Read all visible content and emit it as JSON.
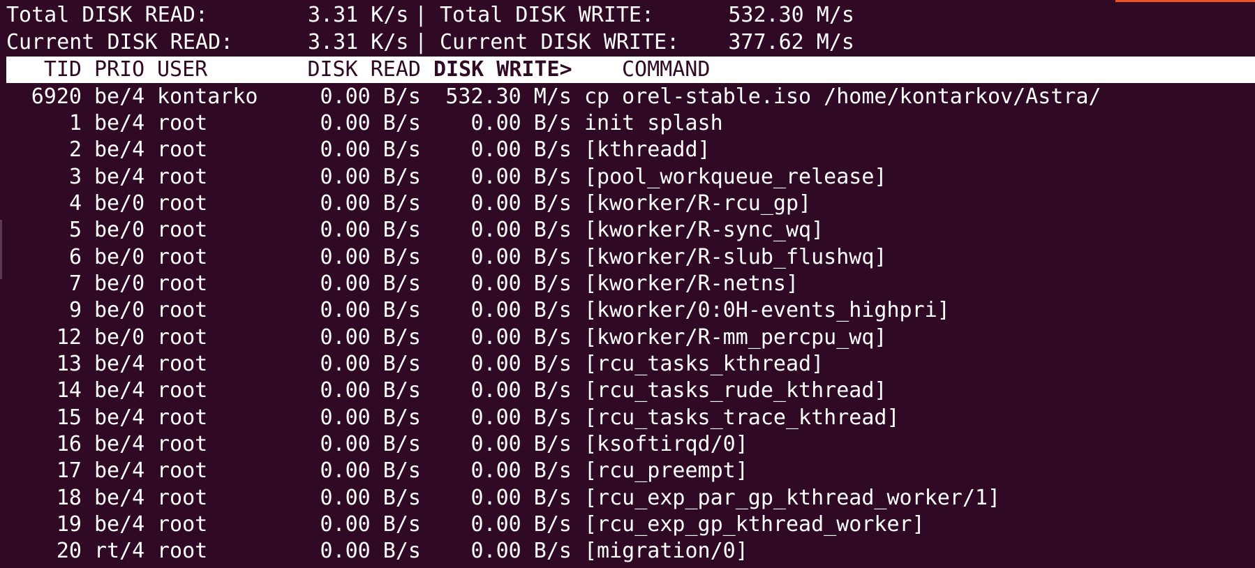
{
  "summary": {
    "total": {
      "read_label": "Total DISK READ:",
      "read_value": "3.31 K/s",
      "separator": "|",
      "write_label": "Total DISK WRITE:",
      "write_value": "532.30 M/s"
    },
    "current": {
      "read_label": "Current DISK READ:",
      "read_value": "3.31 K/s",
      "separator": "|",
      "write_label": "Current DISK WRITE:",
      "write_value": "377.62 M/s"
    }
  },
  "header": {
    "tid": "TID",
    "prio": "PRIO",
    "user": "USER",
    "disk_read": "DISK READ",
    "disk_write": "DISK WRITE>",
    "command": "COMMAND"
  },
  "rows": [
    {
      "tid": "6920",
      "prio": "be/4",
      "user": "kontarko",
      "read": "0.00 B/s",
      "write": "532.30 M/s",
      "command": "cp orel-stable.iso /home/kontarkov/Astra/"
    },
    {
      "tid": "1",
      "prio": "be/4",
      "user": "root",
      "read": "0.00 B/s",
      "write": "0.00 B/s",
      "command": "init splash"
    },
    {
      "tid": "2",
      "prio": "be/4",
      "user": "root",
      "read": "0.00 B/s",
      "write": "0.00 B/s",
      "command": "[kthreadd]"
    },
    {
      "tid": "3",
      "prio": "be/4",
      "user": "root",
      "read": "0.00 B/s",
      "write": "0.00 B/s",
      "command": "[pool_workqueue_release]"
    },
    {
      "tid": "4",
      "prio": "be/0",
      "user": "root",
      "read": "0.00 B/s",
      "write": "0.00 B/s",
      "command": "[kworker/R-rcu_gp]"
    },
    {
      "tid": "5",
      "prio": "be/0",
      "user": "root",
      "read": "0.00 B/s",
      "write": "0.00 B/s",
      "command": "[kworker/R-sync_wq]"
    },
    {
      "tid": "6",
      "prio": "be/0",
      "user": "root",
      "read": "0.00 B/s",
      "write": "0.00 B/s",
      "command": "[kworker/R-slub_flushwq]"
    },
    {
      "tid": "7",
      "prio": "be/0",
      "user": "root",
      "read": "0.00 B/s",
      "write": "0.00 B/s",
      "command": "[kworker/R-netns]"
    },
    {
      "tid": "9",
      "prio": "be/0",
      "user": "root",
      "read": "0.00 B/s",
      "write": "0.00 B/s",
      "command": "[kworker/0:0H-events_highpri]"
    },
    {
      "tid": "12",
      "prio": "be/0",
      "user": "root",
      "read": "0.00 B/s",
      "write": "0.00 B/s",
      "command": "[kworker/R-mm_percpu_wq]"
    },
    {
      "tid": "13",
      "prio": "be/4",
      "user": "root",
      "read": "0.00 B/s",
      "write": "0.00 B/s",
      "command": "[rcu_tasks_kthread]"
    },
    {
      "tid": "14",
      "prio": "be/4",
      "user": "root",
      "read": "0.00 B/s",
      "write": "0.00 B/s",
      "command": "[rcu_tasks_rude_kthread]"
    },
    {
      "tid": "15",
      "prio": "be/4",
      "user": "root",
      "read": "0.00 B/s",
      "write": "0.00 B/s",
      "command": "[rcu_tasks_trace_kthread]"
    },
    {
      "tid": "16",
      "prio": "be/4",
      "user": "root",
      "read": "0.00 B/s",
      "write": "0.00 B/s",
      "command": "[ksoftirqd/0]"
    },
    {
      "tid": "17",
      "prio": "be/4",
      "user": "root",
      "read": "0.00 B/s",
      "write": "0.00 B/s",
      "command": "[rcu_preempt]"
    },
    {
      "tid": "18",
      "prio": "be/4",
      "user": "root",
      "read": "0.00 B/s",
      "write": "0.00 B/s",
      "command": "[rcu_exp_par_gp_kthread_worker/1]"
    },
    {
      "tid": "19",
      "prio": "be/4",
      "user": "root",
      "read": "0.00 B/s",
      "write": "0.00 B/s",
      "command": "[rcu_exp_gp_kthread_worker]"
    },
    {
      "tid": "20",
      "prio": "rt/4",
      "user": "root",
      "read": "0.00 B/s",
      "write": "0.00 B/s",
      "command": "[migration/0]"
    }
  ],
  "colors": {
    "background": "#300a24",
    "foreground": "#ffffff",
    "header_background": "#ffffff",
    "header_foreground": "#300a24",
    "accent": "#e95420"
  }
}
